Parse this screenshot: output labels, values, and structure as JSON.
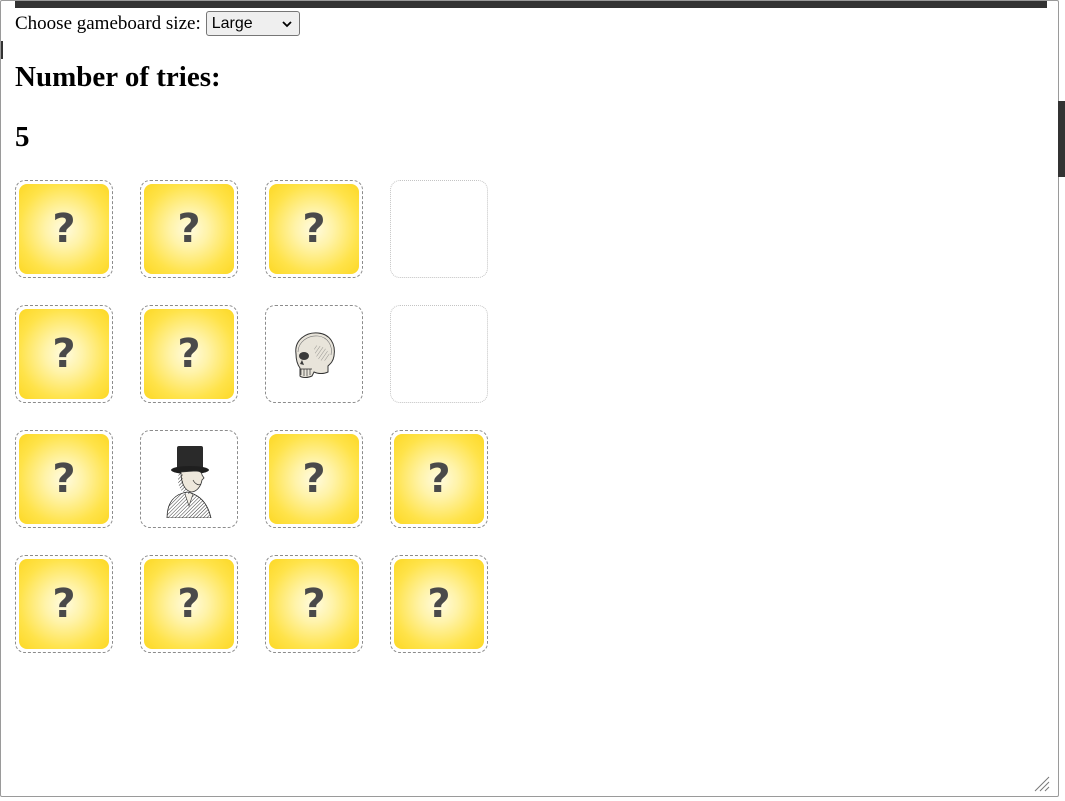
{
  "controls": {
    "size_label": "Choose gameboard size:",
    "size_selected": "Large"
  },
  "tries": {
    "label": "Number of tries:",
    "value": "5"
  },
  "board": {
    "rows": 4,
    "cols": 4,
    "cards": [
      {
        "state": "hidden",
        "symbol": "?"
      },
      {
        "state": "hidden",
        "symbol": "?"
      },
      {
        "state": "hidden",
        "symbol": "?"
      },
      {
        "state": "matched"
      },
      {
        "state": "hidden",
        "symbol": "?"
      },
      {
        "state": "hidden",
        "symbol": "?"
      },
      {
        "state": "revealed",
        "image": "skull-engraving"
      },
      {
        "state": "matched"
      },
      {
        "state": "hidden",
        "symbol": "?"
      },
      {
        "state": "revealed",
        "image": "top-hat-man-engraving"
      },
      {
        "state": "hidden",
        "symbol": "?"
      },
      {
        "state": "hidden",
        "symbol": "?"
      },
      {
        "state": "hidden",
        "symbol": "?"
      },
      {
        "state": "hidden",
        "symbol": "?"
      },
      {
        "state": "hidden",
        "symbol": "?"
      },
      {
        "state": "hidden",
        "symbol": "?"
      }
    ]
  },
  "colors": {
    "card_yellow": "#fcd825",
    "question_mark": "#4a4a4a",
    "top_bar": "#333333"
  }
}
